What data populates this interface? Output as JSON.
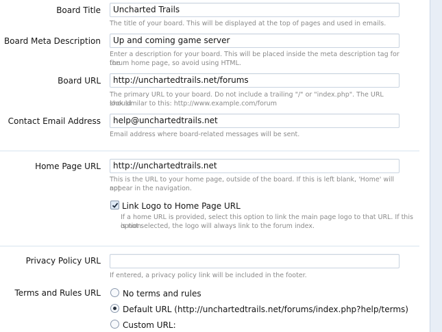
{
  "fields": {
    "board_title": {
      "label": "Board Title",
      "value": "Uncharted Trails",
      "hint": "The title of your board. This will be displayed at the top of pages and used in emails."
    },
    "board_meta_description": {
      "label": "Board Meta Description",
      "value": "Up and coming game server",
      "hint_line1": "Enter a description for your board. This will be placed inside the meta description tag for the",
      "hint_line2": "forum home page, so avoid using HTML."
    },
    "board_url": {
      "label": "Board URL",
      "value": "http://unchartedtrails.net/forums",
      "hint_line1": "The primary URL to your board. Do not include a trailing \"/\" or \"index.php\". The URL should",
      "hint_line2": "look similar to this: http://www.example.com/forum"
    },
    "contact_email": {
      "label": "Contact Email Address",
      "value": "help@unchartedtrails.net",
      "hint": "Email address where board-related messages will be sent."
    },
    "home_page_url": {
      "label": "Home Page URL",
      "value": "http://unchartedtrails.net",
      "hint_line1": "This is the URL to your home page, outside of the board. If this is left blank, 'Home' will not",
      "hint_line2": "appear in the navigation."
    },
    "link_logo": {
      "label": "Link Logo to Home Page URL",
      "checked": true,
      "hint_line1": "If a home URL is provided, select this option to link the main page logo to that URL. If this option",
      "hint_line2": "is not selected, the logo will always link to the forum index."
    },
    "privacy_policy_url": {
      "label": "Privacy Policy URL",
      "value": "",
      "hint": "If entered, a privacy policy link will be included in the footer."
    },
    "terms_rules_url": {
      "label": "Terms and Rules URL",
      "options": [
        {
          "label": "No terms and rules",
          "checked": false
        },
        {
          "label": "Default URL (http://unchartedtrails.net/forums/index.php?help/terms)",
          "checked": true
        },
        {
          "label": "Custom URL:",
          "checked": false
        }
      ]
    }
  }
}
